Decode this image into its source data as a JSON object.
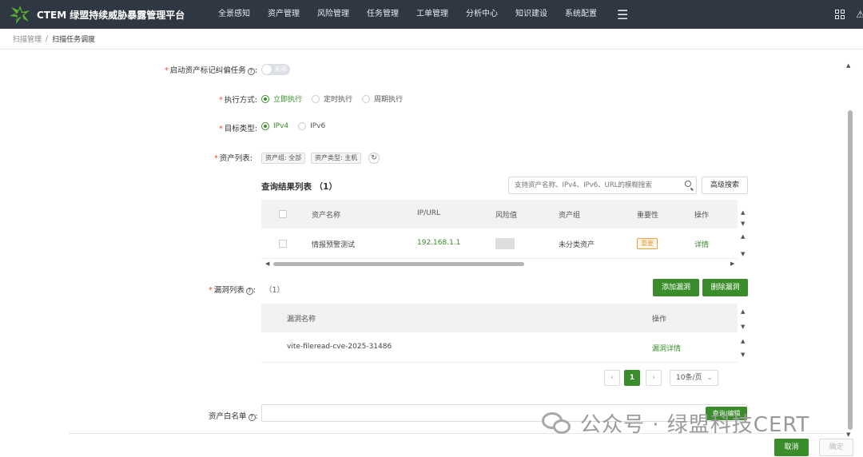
{
  "app": {
    "title": "CTEM 绿盟持续威胁暴露管理平台"
  },
  "nav": {
    "items": [
      "全景感知",
      "资产管理",
      "风险管理",
      "任务管理",
      "工单管理",
      "分析中心",
      "知识建设",
      "系统配置"
    ],
    "menu_icon": "hamburger-icon"
  },
  "breadcrumb": {
    "parent": "扫描管理",
    "separator": "/",
    "current": "扫描任务调度"
  },
  "form": {
    "mark_task": {
      "label": "启动资产标记纠偏任务",
      "switch_text": "关闭",
      "switch_on": false
    },
    "exec_mode": {
      "label": "执行方式:",
      "options": [
        "立即执行",
        "定时执行",
        "周期执行"
      ],
      "selected": "立即执行"
    },
    "target_type": {
      "label": "目标类型:",
      "options": [
        "IPv4",
        "IPv6"
      ],
      "selected": "IPv4"
    },
    "asset_list": {
      "label": "资产列表:",
      "tags": [
        "资产组: 全部",
        "资产类型: 主机"
      ]
    }
  },
  "query_panel": {
    "title": "查询结果列表 （1）",
    "search_placeholder": "支持资产名称、IPv4、IPv6、URL的模糊搜索",
    "advanced_search": "高级搜索",
    "columns": [
      "资产名称",
      "IP/URL",
      "风险值",
      "资产组",
      "重要性",
      "操作"
    ],
    "rows": [
      {
        "name": "情报预警测试",
        "ip": "192.168.1.1",
        "group": "未分类资产",
        "importance": "重要",
        "action": "详情"
      }
    ]
  },
  "vuln": {
    "label": "漏洞列表",
    "count": "（1）",
    "add_button": "添加漏洞",
    "delete_button": "删除漏洞",
    "columns": [
      "漏洞名称",
      "操作"
    ],
    "rows": [
      {
        "name": "vite-fileread-cve-2025-31486",
        "action": "漏洞详情"
      }
    ],
    "pager": {
      "current": "1",
      "prev": "‹",
      "next": "›",
      "page_size": "10条/页"
    }
  },
  "whitelist": {
    "label": "资产白名单",
    "button": "查询/编辑"
  },
  "footer": {
    "cancel": "取消",
    "confirm": "确定"
  },
  "watermark": {
    "text": "公众号 · 绿盟科技CERT"
  },
  "colors": {
    "primary": "#3a8d2a",
    "topbar": "#2f3742",
    "required": "#e64b3b",
    "importance": "#e6a23c"
  }
}
